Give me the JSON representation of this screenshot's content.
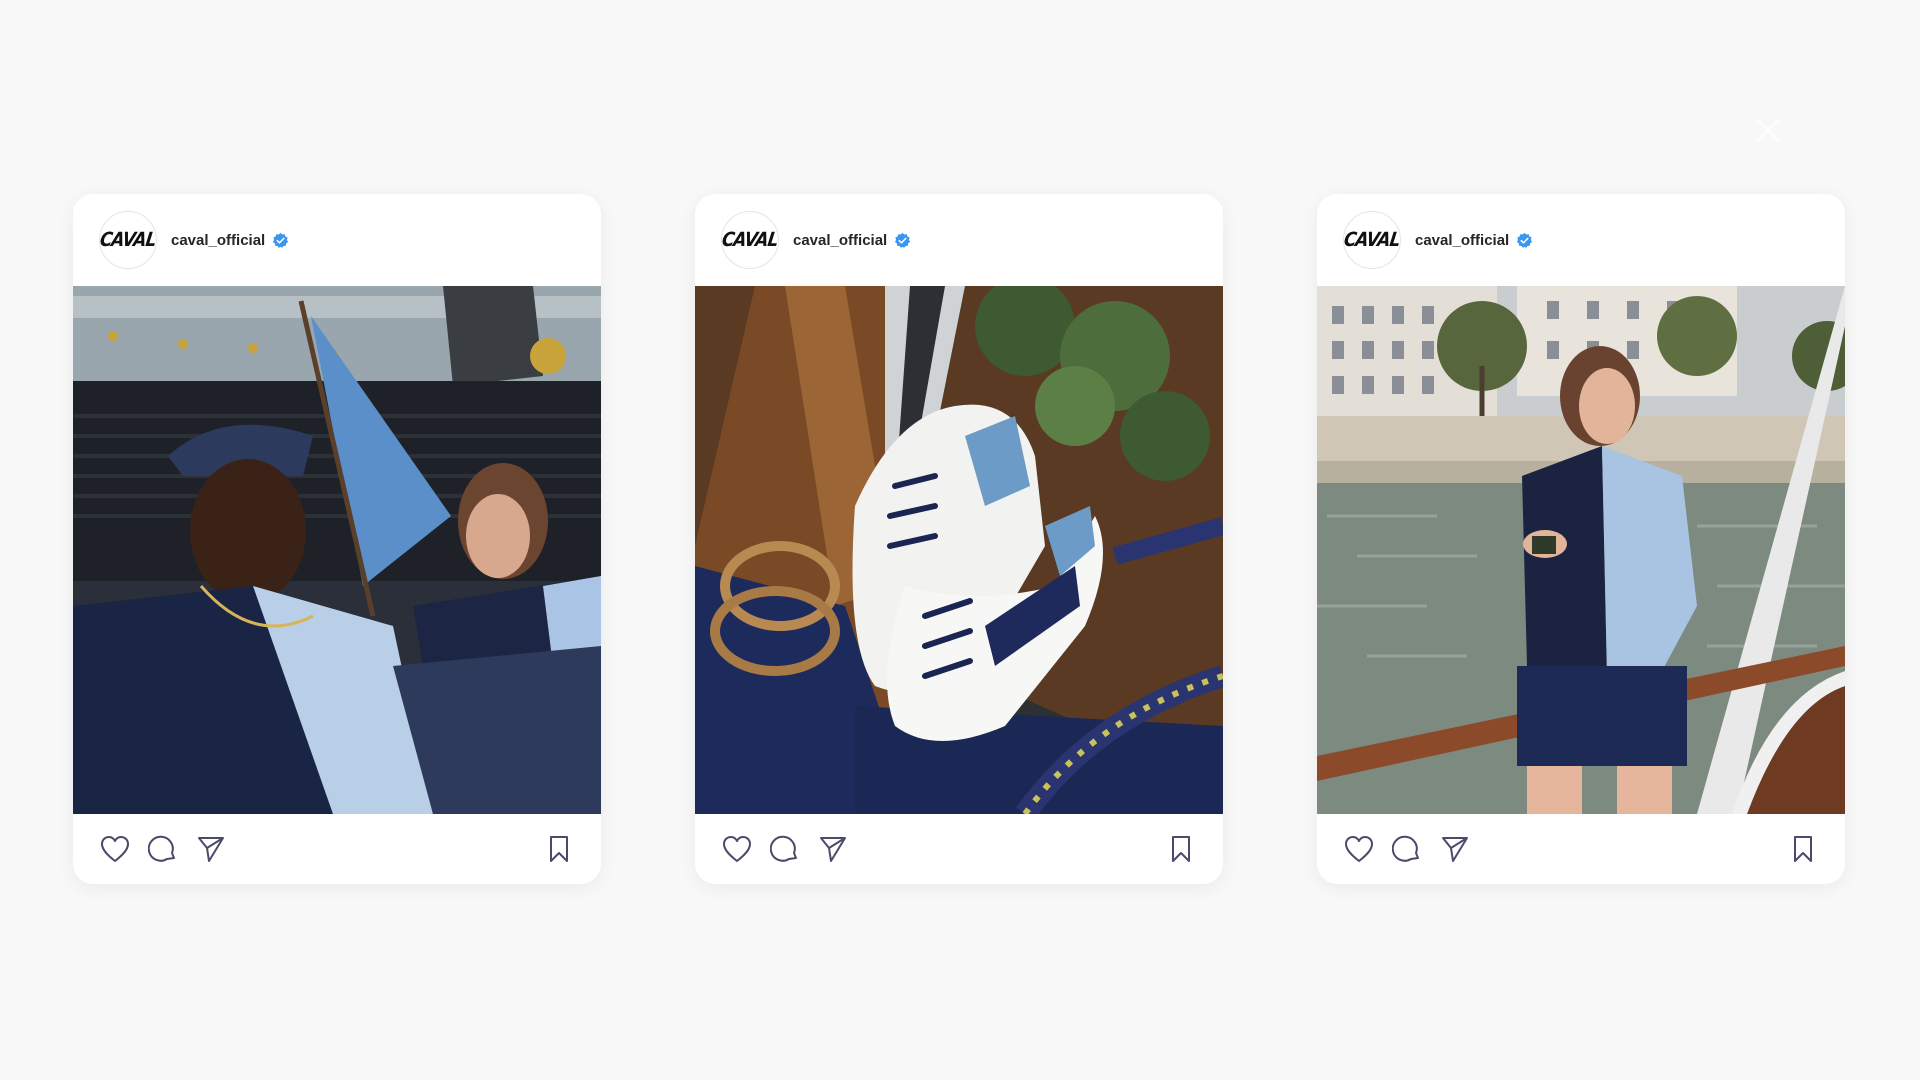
{
  "overlay": {
    "close_icon": "close-icon"
  },
  "colors": {
    "background": "#f8f8f8",
    "card": "#ffffff",
    "icon_stroke": "#4a4a6a",
    "verified_blue": "#3897f0",
    "username": "#262626"
  },
  "posts": [
    {
      "username": "caval_official",
      "avatar_logo": "CAVAL",
      "verified": true,
      "image_icon": "photo-two-models-on-boat",
      "actions": [
        "heart-icon",
        "comment-icon",
        "share-icon",
        "bookmark-icon"
      ]
    },
    {
      "username": "caval_official",
      "avatar_logo": "CAVAL",
      "verified": true,
      "image_icon": "photo-sneakers-on-boat",
      "actions": [
        "heart-icon",
        "comment-icon",
        "share-icon",
        "bookmark-icon"
      ]
    },
    {
      "username": "caval_official",
      "avatar_logo": "CAVAL",
      "verified": true,
      "image_icon": "photo-model-on-river-seine",
      "actions": [
        "heart-icon",
        "comment-icon",
        "share-icon",
        "bookmark-icon"
      ]
    }
  ]
}
